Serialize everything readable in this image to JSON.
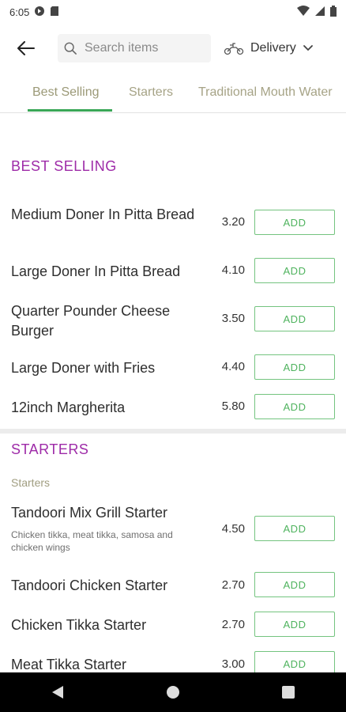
{
  "status_bar": {
    "time": "6:05"
  },
  "toolbar": {
    "search_placeholder": "Search items",
    "delivery_label": "Delivery"
  },
  "tabs": [
    {
      "label": "Best Selling",
      "active": true
    },
    {
      "label": "Starters",
      "active": false
    },
    {
      "label": "Traditional Mouth Water",
      "active": false
    }
  ],
  "best_selling": {
    "title": "BEST SELLING",
    "items": [
      {
        "name": "Medium Doner In Pitta Bread",
        "price": "3.20",
        "button": "ADD"
      },
      {
        "name": "Large Doner In Pitta Bread",
        "price": "4.10",
        "button": "ADD"
      },
      {
        "name": "Quarter Pounder Cheese Burger",
        "price": "3.50",
        "button": "ADD"
      },
      {
        "name": "Large Doner with Fries",
        "price": "4.40",
        "button": "ADD"
      },
      {
        "name": "12inch Margherita",
        "price": "5.80",
        "button": "ADD"
      }
    ]
  },
  "starters": {
    "title": "STARTERS",
    "subheading": "Starters",
    "items": [
      {
        "name": "Tandoori Mix Grill Starter",
        "description": "Chicken tikka, meat tikka, samosa and chicken wings",
        "price": "4.50",
        "button": "ADD"
      },
      {
        "name": "Tandoori Chicken Starter",
        "price": "2.70",
        "button": "ADD"
      },
      {
        "name": "Chicken Tikka Starter",
        "price": "2.70",
        "button": "ADD"
      },
      {
        "name": "Meat Tikka Starter",
        "price": "3.00",
        "button": "ADD"
      }
    ]
  },
  "colors": {
    "section_title": "#9e2ba8",
    "add_button": "#4fb35e",
    "tab_indicator": "#3aa757"
  }
}
